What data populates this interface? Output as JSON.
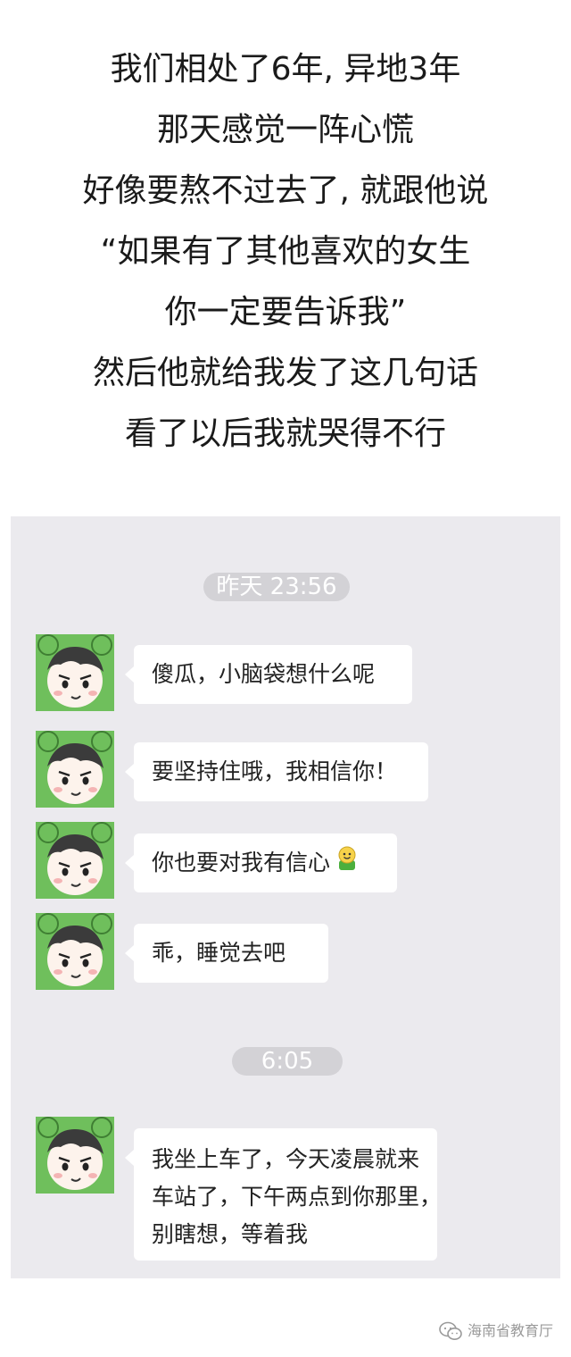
{
  "caption": {
    "lines": [
      "我们相处了6年, 异地3年",
      "那天感觉一阵心慌",
      "好像要熬不过去了, 就跟他说",
      "“如果有了其他喜欢的女生",
      "你一定要告诉我”",
      "然后他就给我发了这几句话",
      "看了以后我就哭得不行"
    ]
  },
  "chat": {
    "timestamps": [
      "昨天 23:56",
      "6:05"
    ],
    "messages": [
      {
        "text": "傻瓜，小脑袋想什么呢"
      },
      {
        "text": "要坚持住哦，我相信你！"
      },
      {
        "text": "你也要对我有信心",
        "emoji": "smiley-emoji-icon"
      },
      {
        "text": "乖，睡觉去吧"
      },
      {
        "lines": [
          "我坐上车了，今天凌晨就来",
          "车站了，下午两点到你那里，",
          "别瞎想，等着我"
        ]
      }
    ]
  },
  "watermark": {
    "text": "海南省教育厅"
  },
  "colors": {
    "panel_bg": "#ebeaee",
    "bubble_bg": "#ffffff",
    "timestamp_bg": "#d3d2d6",
    "avatar_green": "#6fbf5c"
  }
}
